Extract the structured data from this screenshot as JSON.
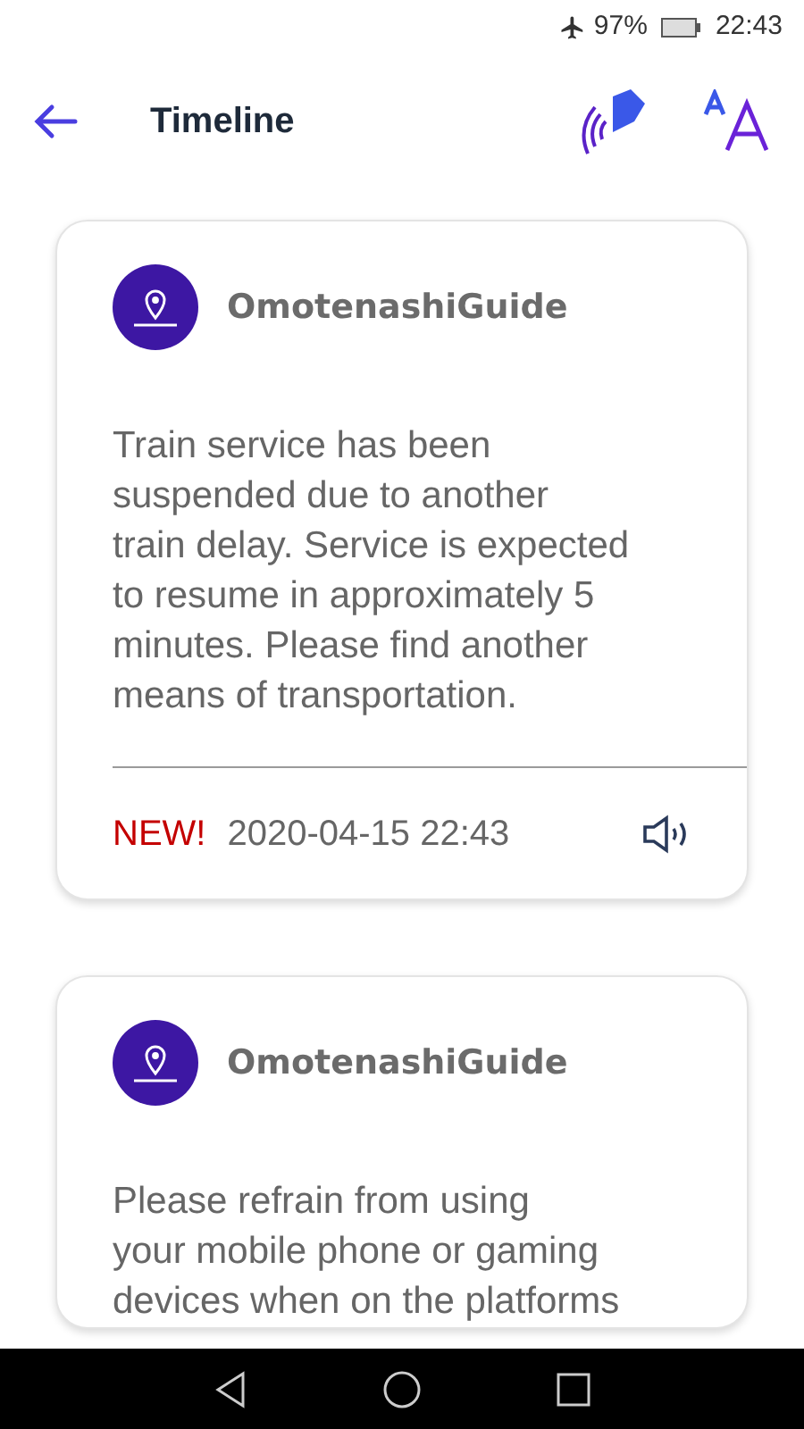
{
  "status_bar": {
    "battery": "97%",
    "time": "22:43"
  },
  "header": {
    "title": "Timeline"
  },
  "cards": [
    {
      "sender": "OmotenashiGuide",
      "message": "Train service has been\nsuspended due to another\ntrain delay. Service is expected\nto resume in approximately 5\nminutes. Please find another\nmeans of transportation.",
      "badge": "NEW!",
      "date": "2020-04-15 22:43"
    },
    {
      "sender": "OmotenashiGuide",
      "message": "Please refrain from using\nyour mobile phone or gaming\ndevices when on the platforms"
    }
  ]
}
